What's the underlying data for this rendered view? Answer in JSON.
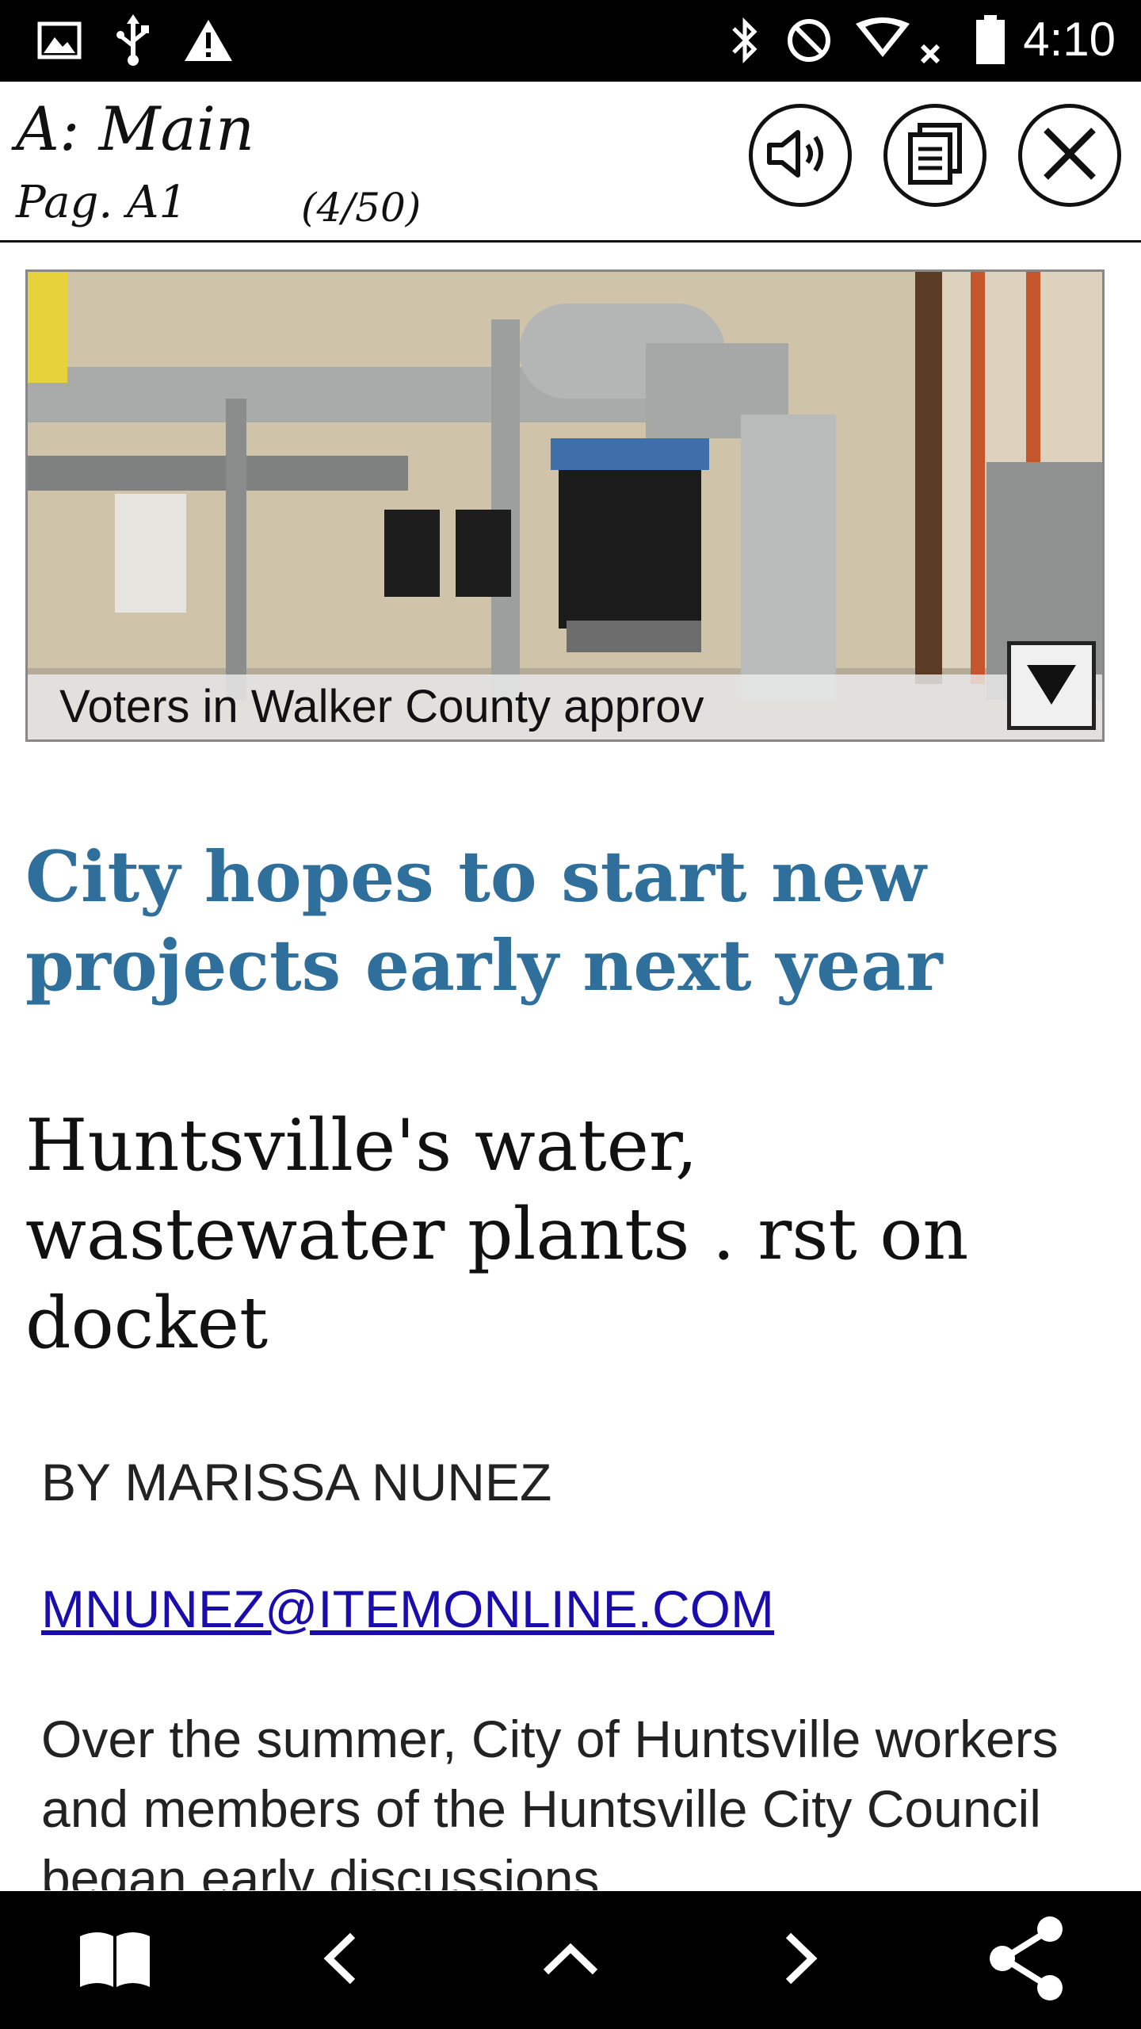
{
  "status_bar": {
    "time": "4:10",
    "icons": [
      "image-icon",
      "usb-icon",
      "warning-icon",
      "bluetooth-icon",
      "do-not-disturb-icon",
      "wifi-off-icon",
      "battery-icon"
    ],
    "background": "#000000"
  },
  "header": {
    "section_title": "A: Main",
    "page_label": "Pag. A1",
    "page_count": "(4/50)",
    "buttons": [
      "speaker-icon",
      "document-icon",
      "close-icon"
    ]
  },
  "photo": {
    "caption": "Voters in Walker County approv",
    "toggle_icon": "triangle-down-icon"
  },
  "article": {
    "headline": "City hopes to start new projects early next year",
    "subhead": "Huntsville's water, wastewater plants . rst on docket",
    "byline": "BY MARISSA NUNEZ",
    "email": "MNUNEZ@ITEMONLINE.COM",
    "body": "Over the summer, City of Huntsville workers and members of the Huntsville City Council began early discussions"
  },
  "colors": {
    "headline": "#2e6f9b",
    "link": "#1a0dab"
  },
  "bottom_bar": {
    "buttons": [
      "book-icon",
      "chevron-left-icon",
      "chevron-up-icon",
      "chevron-right-icon",
      "share-icon"
    ]
  }
}
